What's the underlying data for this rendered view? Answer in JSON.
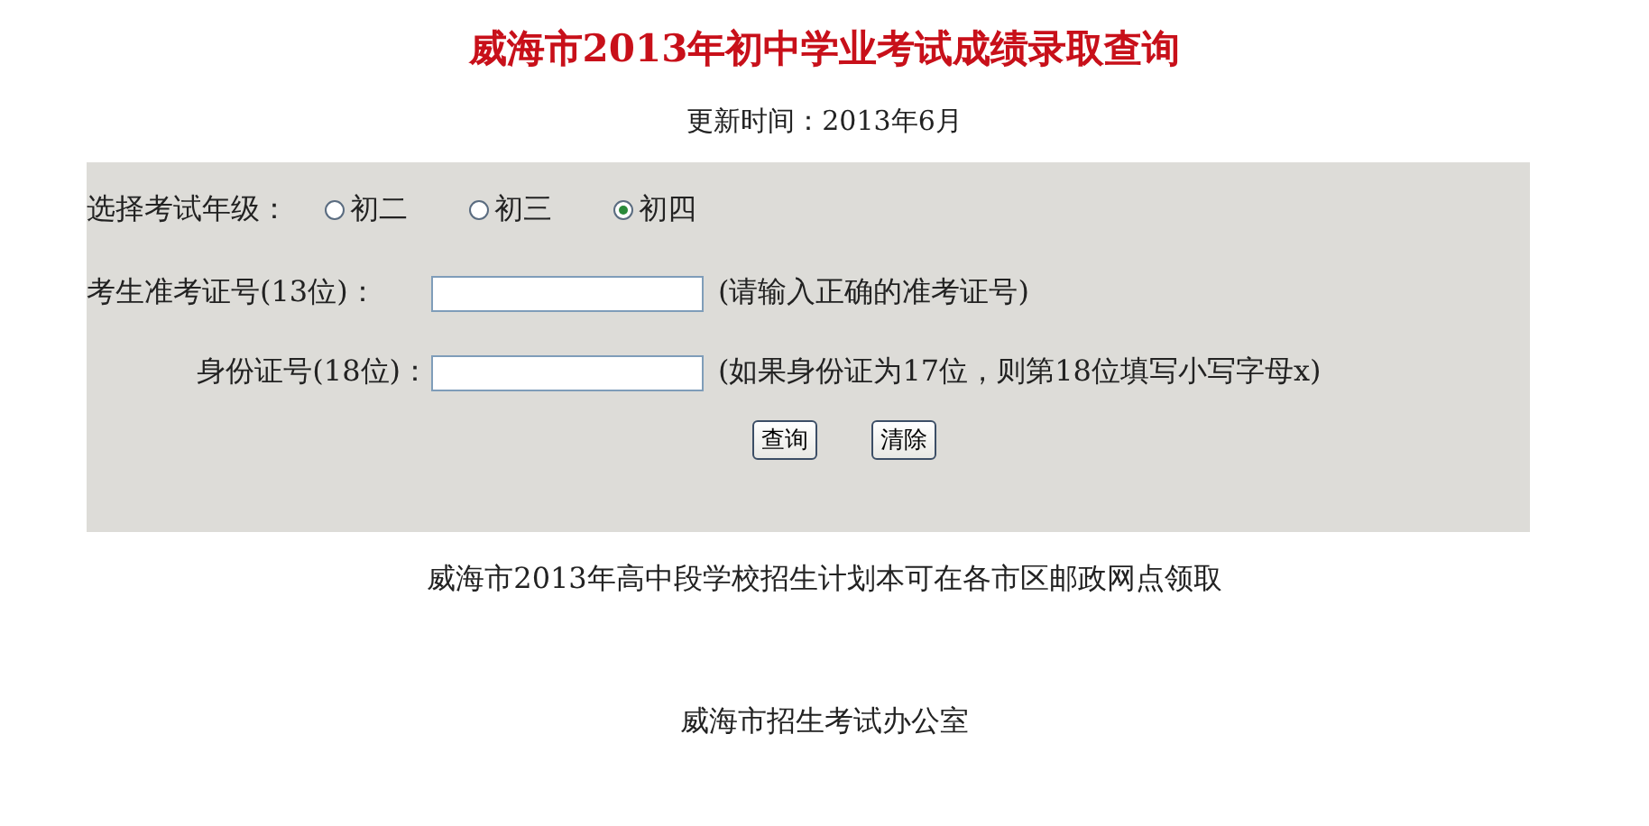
{
  "title": "威海市2013年初中学业考试成绩录取查询",
  "updated": "更新时间：2013年6月",
  "form": {
    "grade_label": "选择考试年级：",
    "grades": [
      {
        "label": "初二",
        "selected": false
      },
      {
        "label": "初三",
        "selected": false
      },
      {
        "label": "初四",
        "selected": true
      }
    ],
    "fields": [
      {
        "label": "考生准考证号(13位)：",
        "note": "(请输入正确的准考证号)"
      },
      {
        "label": "身份证号(18位)：",
        "note": "(如果身份证为17位，则第18位填写小写字母x)"
      }
    ],
    "buttons": [
      "查询",
      "清除"
    ]
  },
  "notice": "威海市2013年高中段学校招生计划本可在各市区邮政网点领取",
  "office": "威海市招生考试办公室"
}
